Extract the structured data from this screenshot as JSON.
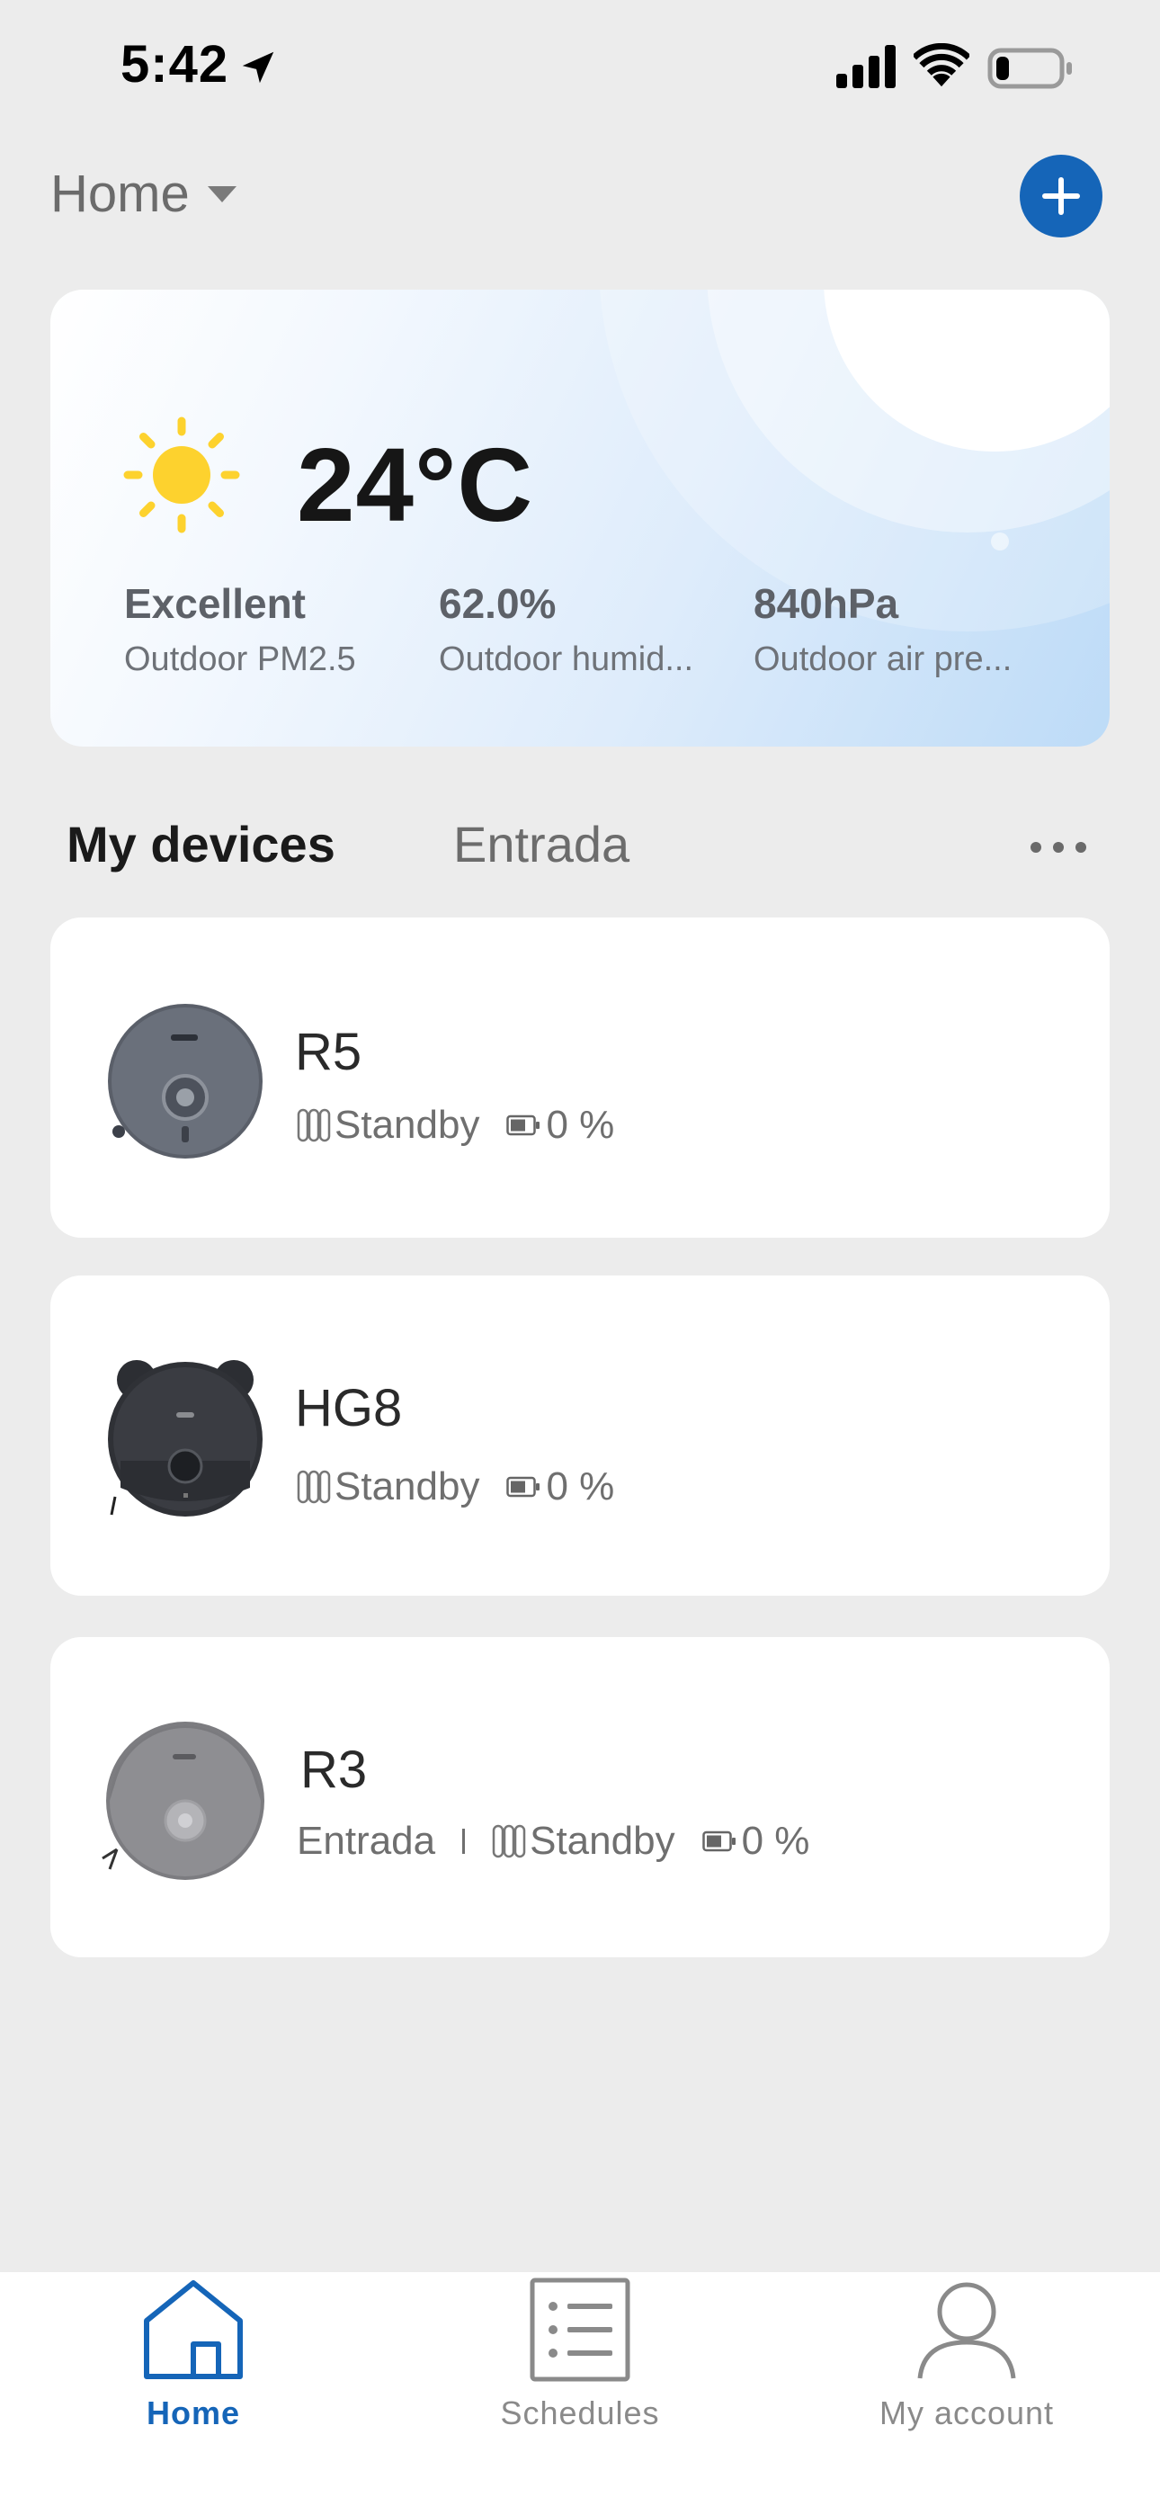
{
  "status_bar": {
    "time": "5:42",
    "icons": [
      "location-arrow-icon",
      "cellular-signal-icon",
      "wifi-icon",
      "battery-low-icon"
    ]
  },
  "header": {
    "home_title": "Home",
    "add_icon": "plus-icon"
  },
  "weather": {
    "icon": "sun-icon",
    "temperature": "24°C",
    "metrics": [
      {
        "value": "Excellent",
        "label": "Outdoor PM2.5"
      },
      {
        "value": "62.0%",
        "label": "Outdoor humid..."
      },
      {
        "value": "840hPa",
        "label": "Outdoor air pre..."
      }
    ]
  },
  "tabs": {
    "active": "My devices",
    "items": [
      "My devices",
      "Entrada"
    ],
    "more_icon": "ellipsis-icon"
  },
  "devices": [
    {
      "name": "R5",
      "room": "",
      "status": "Standby",
      "battery": "0 %"
    },
    {
      "name": "HG8",
      "room": "",
      "status": "Standby",
      "battery": "0 %"
    },
    {
      "name": "R3",
      "room": "Entrada",
      "status": "Standby",
      "battery": "0 %"
    }
  ],
  "bottom_nav": {
    "items": [
      {
        "label": "Home",
        "icon": "home-icon",
        "active": true
      },
      {
        "label": "Schedules",
        "icon": "schedule-list-icon",
        "active": false
      },
      {
        "label": "My account",
        "icon": "person-icon",
        "active": false
      }
    ]
  },
  "colors": {
    "accent": "#1565b8",
    "background": "#ececec",
    "card": "#ffffff",
    "sun": "#fdd22e"
  }
}
